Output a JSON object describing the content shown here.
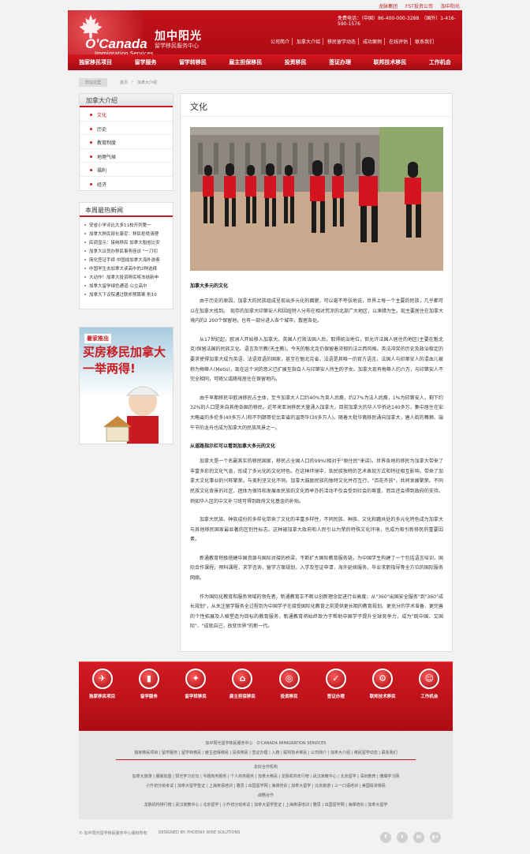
{
  "header": {
    "top_links": [
      "龙脉集团",
      "FST投资公司",
      "加中阳光"
    ],
    "phone": "免费电话：（中国）86-400-000-3288　（国外）1-416-590-1576",
    "brand": "O'Canada",
    "brand_sub": "Immigration Services",
    "cn_name": "加中阳光",
    "cn_sub": "留学移民服务中心",
    "sub_links": [
      "公司简介",
      "加拿大介绍",
      "移民留学动态",
      "成功案例",
      "在线评估",
      "联系我们"
    ],
    "nav": [
      "独家移民项目",
      "留学服务",
      "留学转移民",
      "雇主担保移民",
      "投资移民",
      "签证办理",
      "联邦技术移民",
      "工作机会"
    ]
  },
  "breadcrumb": {
    "here": "您在这里",
    "items": [
      "首页",
      "加拿大介绍"
    ]
  },
  "sidebar": {
    "title": "加拿大介绍",
    "items": [
      "文化",
      "历史",
      "教育制度",
      "地理气候",
      "福利",
      "经济"
    ],
    "news_title": "本周最热新闻",
    "news": [
      "安省小学评比大多11校开列第一",
      "加拿大移民部长康尼：移民拒绝清理",
      "民调显示：接纳移民 加拿大魁省比安",
      "加拿大议员办移民事务座谈 \"一刀切",
      "简化签证手续 中国成加拿大海外游客",
      "中国学生去加拿大读高中的2种选择",
      "大动作！加拿大投资移民将冻结新申",
      "加拿大留学绿色通道-公立高中",
      "加拿大下议院通过联邦预算案 削10"
    ],
    "promo_line1": "暑家推出",
    "promo_line2": "买房移民加拿大一举两得!"
  },
  "content": {
    "title": "文化",
    "paras": [
      {
        "h": true,
        "t": "加拿大多元的文化"
      },
      {
        "t": "由于历史的原因，加拿大的民族组成呈现出多元化的面貌，可以毫不夸张地说，世界上每一个主要的民族，几乎都可以在加拿大找到。　现存的加拿大印第安人和因纽特人分布在相对荒凉的北部广大地区，以渔猎为生。现主要居住在加拿大境内的2 200个保留地，也有一部分进入各个城市，散居各处。"
      },
      {
        "t": "从17世纪起，欧洲人开始移入加拿大。英国人打败法国人后，取得统治地位，但允许法国人居住的地区(主要在魁北克)保留法国的民族文化、语言及宗教(天主教)。今天的魁北克仍保留着浓郁的法兰西风格。英法冲突的历史及政治稳定的要求使得加拿大成为英语、法语双语的国家，甚至在魁北克省，法语是其唯一的官方语言。法国人与印第安人的混血儿被称为梅蒂人(Metis)，现在这个词的意义已扩展至指白人与印第安人所生的子女。加拿大现有梅蒂人约六万，与印第安人不完全相同，可随父或随母居住在保留地内。"
      },
      {
        "t": "由于早期移民中欧洲移民占主体，至今加拿大人口约40%为英人后裔，约27%为法人后裔，1%为印第安人，剩下约32%的人口是来自其他各国的移民。近年来亚洲移民大量涌入加拿大，目前加拿大的华人华侨达140多万，集中居住在安大略省的多伦多(40多万人)和不列颠哥伦比亚省的温哥华(30多万人)。随着大批华裔移民涌向加拿大，唐人街的舞狮、端午节的龙舟也成为加拿大的民族风景之一。"
      },
      {
        "h": true,
        "t": "从道路指示栏可以看到加拿大多元的文化"
      },
      {
        "t": "加拿大是一个名副其实的移民国家，移民占全国人口的99%(相对于\"原住民\"来讲)。世界各地的移民为加拿大带来了丰富多彩的文化气息，形成了多元化的文化特色。在这种环境中，各民族独特的艺术表现方式和特征相互影响，带来了加拿大文化事业的兴旺繁荣。与美利坚文化不同，加拿大鼓励民族的独特文化并存互行，\"百花齐放\"，共同发展繁荣。不同民族文化背景的社区、团体为保持和发展本民族的文化而举办的活动不仅会受到社会的尊重，而且还会得到政府的支持。例如华人区的中文补习班可得到政府文化基金的补贴。"
      },
      {
        "t": "加拿大民族、种族成份的多样化带来了文化的丰富多样性，不同民族、种族、文化和籍共处的多元化特色成为加拿大与其他移民国家最显著的区别性标志。这种被加拿大政府和人民引以为荣的特殊文化环境，也成为吸引新移民的重要因素。"
      },
      {
        "t": "新通教育积极搭建中国资源与国际对接的桥梁，不断扩大国际教育服务链，为中国学生构建了一个包括语言培训，国际合作课程，预科课程，求学咨询，留学方案规划，入学及签证申请，海外延续服务，毕业求职指导等全方位的国际服务网络。"
      },
      {
        "t": "作为国际化教育和服务领域的领先者，新通教育正不断以创新理念促进行业高度；从\"360°出国安全服务\"到\"360°成长规划\"，从关注留学服务全过程到为中国学子在接受国际化教育之前提供更长期的教育规划、更充分的学术准备、更完善的个性拓展及人格塑造为目标的教育服务，新通教育将始终致力于帮助中国学子提升全球竞争力，成为\"既中国、又国际\"、\"成就自己，改变世界\"的新一代。"
      }
    ]
  },
  "footer": {
    "icons": [
      {
        "label": "独家移民项目",
        "glyph": "✈"
      },
      {
        "label": "留学服务",
        "glyph": "▮"
      },
      {
        "label": "留学转移民",
        "glyph": "✦"
      },
      {
        "label": "雇主担保移民",
        "glyph": "⌂"
      },
      {
        "label": "投资移民",
        "glyph": "◎"
      },
      {
        "label": "签证办理",
        "glyph": "✓"
      },
      {
        "label": "联邦技术移民",
        "glyph": "⚙"
      },
      {
        "label": "工作机会",
        "glyph": "☺"
      }
    ],
    "org": "加中阳光留学移民服务中心　O'CANADA IMMIGRATION SERVICES",
    "links_row": "独家移民项目 | 留学服务 | 留学转移民 | 雇主担保移民 | 投资移民 | 签证办理 | 入籍 | 联邦技术移民 | 公司简介 | 加拿大介绍 | 移民留学动态 | 联系我们",
    "friend_title": "友好合作机构",
    "friend_rows": [
      "加拿大旅游 | 服装加盟 | 阳光学习论坛 | 今题商务服务 | 个人商务服务 | 加拿大移民 | 龙脉机构年行榜 | 武汉家教中心 | 北京留学 | 深圳教育 | 珊瑚学习网",
      "小升初分班考试 | 加拿大留学签证 | 上海英语培训 | 雅思 | 出国留学网 | 海课培训 | 加拿大留学 | 北京旅游 | 三一口语培训 | 美国投资移民",
      "战略合作",
      "龙脉机构排行榜 | 武汉家教中心 | 北京留学 | 小升初分班考试 | 加拿大留学签证 | 上海英语培训 | 雅思 | 出国留学网 | 海课培训 | 加拿大留学"
    ],
    "copyright": "© 加中阳光留学移民服务中心版权所有",
    "designed": "DESIGNED BY: PHOENIX WISE SOLUTIONS",
    "social": [
      "f",
      "t",
      "in",
      "g+"
    ]
  },
  "colors": {
    "accent": "#c81a20",
    "bg": "#f2f2f2"
  }
}
